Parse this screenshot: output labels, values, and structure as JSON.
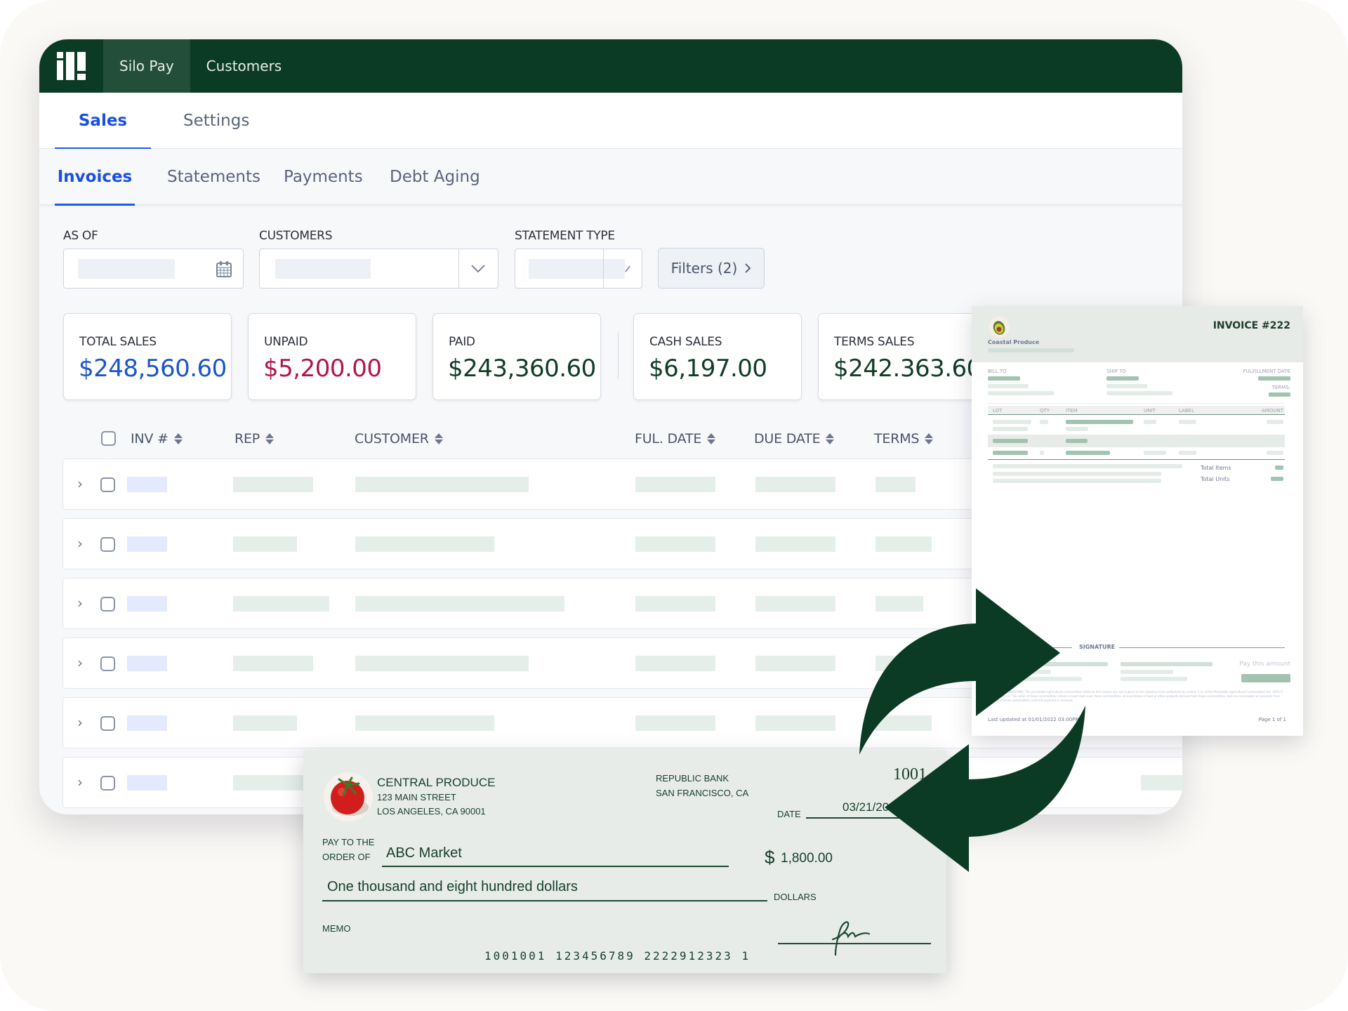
{
  "topbar": {
    "logo": "silo-logo",
    "items": [
      {
        "label": "Silo Pay",
        "active": true
      },
      {
        "label": "Customers",
        "active": false
      }
    ]
  },
  "tabs": [
    {
      "label": "Sales",
      "active": true
    },
    {
      "label": "Settings",
      "active": false
    }
  ],
  "subtabs": [
    {
      "label": "Invoices",
      "active": true
    },
    {
      "label": "Statements",
      "active": false
    },
    {
      "label": "Payments",
      "active": false
    },
    {
      "label": "Debt Aging",
      "active": false
    }
  ],
  "filters": {
    "as_of_label": "AS OF",
    "customers_label": "CUSTOMERS",
    "statement_type_label": "STATEMENT TYPE",
    "filters_button": "Filters (2)",
    "calendar_icon": "calendar-icon",
    "dropdown_icon": "chevron-down-icon"
  },
  "stats": [
    {
      "label": "TOTAL SALES",
      "value": "$248,560.60",
      "color": "#1a56c8"
    },
    {
      "label": "UNPAID",
      "value": "$5,200.00",
      "color": "#b3154a"
    },
    {
      "label": "PAID",
      "value": "$243,360.60",
      "color": "#0f3d27"
    },
    {
      "label": "CASH SALES",
      "value": "$6,197.00",
      "color": "#0f3d27"
    },
    {
      "label": "TERMS SALES",
      "value": "$242.363.60",
      "color": "#0f3d27"
    }
  ],
  "table": {
    "columns": [
      "INV #",
      "REP",
      "CUSTOMER",
      "FUL. DATE",
      "DUE DATE",
      "TERMS"
    ],
    "row_count_visible": 6
  },
  "invoice": {
    "company": "Coastal Produce",
    "title": "INVOICE #222",
    "bill_to": "BILL TO",
    "ship_to": "SHIP TO",
    "fulfillment_date": "FULFILLMENT DATE",
    "terms": "TERMS:",
    "line_columns": [
      "LOT",
      "QTY",
      "ITEM",
      "UNIT",
      "LABEL",
      "AMOUNT"
    ],
    "total_items": "Total Items",
    "total_units": "Total Units",
    "signature": "SIGNATURE",
    "pay_this_amount": "Pay this amount",
    "terms_conditions": "TERMS AND CONDITIONS: The perishable agricultural commodities listed on this invoice are sold subject to the statutory trust authorized by section 5 (c) of the Perishable Agricultural Commodities Act, 1930 (7 U.S.C. 499e (c)). The seller of these commodities retains a trust claim over these commodities, all inventories of food or other products derived from these commodities, and any receivables or proceeds from the sale of these commodities until full payment is received.",
    "last_updated": "Last updated at 01/01/2022 03:00PM",
    "page": "Page 1 of 1"
  },
  "check": {
    "payer_name": "CENTRAL PRODUCE",
    "payer_address1": "123 MAIN STREET",
    "payer_address2": "LOS ANGELES, CA 90001",
    "bank_name": "REPUBLIC BANK",
    "bank_city": "SAN FRANCISCO, CA",
    "check_number": "1001",
    "date_label": "DATE",
    "date": "03/21/2023",
    "pay_to_label_1": "PAY TO THE",
    "pay_to_label_2": "ORDER OF",
    "payee": "ABC Market",
    "currency_symbol": "$",
    "amount": "1,800.00",
    "amount_words": "One thousand and eight hundred dollars",
    "dollars_label": "DOLLARS",
    "memo_label": "MEMO",
    "micr": "⑆1001⑆001⑈ ⑆123456789 2222⑆9⑆23231⑈",
    "micr_display": "1001001 123456789 2222912323 1"
  },
  "colors": {
    "brand_dark": "#0b3b24",
    "brand_active": "#234f3a",
    "accent_blue": "#1a5cf0",
    "unpaid_red": "#b3154a"
  }
}
